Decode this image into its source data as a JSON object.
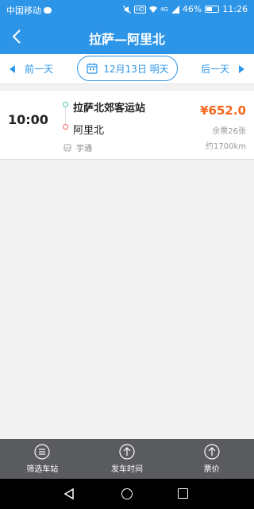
{
  "status_bar": {
    "carrier": "中国移动",
    "hd_badge": "HD",
    "network": "4G",
    "battery": "46%",
    "time": "11:26"
  },
  "nav": {
    "title": "拉萨—阿里北",
    "back_icon": "chevron-left-icon"
  },
  "date_bar": {
    "prev_label": "前一天",
    "date_label": "12月13日 明天",
    "next_label": "后一天",
    "calendar_icon": "calendar-icon"
  },
  "trips": [
    {
      "time": "10:00",
      "from": "拉萨北郊客运站",
      "to": "阿里北",
      "company": "宇通",
      "price": "¥652.0",
      "seats": "余票26张",
      "distance": "约1700km"
    }
  ],
  "bottom_bar": {
    "filter_label": "筛选车站",
    "time_sort_label": "发车时间",
    "price_sort_label": "票价"
  },
  "colors": {
    "primary": "#2d95e8",
    "price": "#f5661b",
    "bottom_bar": "#5a5b5e"
  }
}
